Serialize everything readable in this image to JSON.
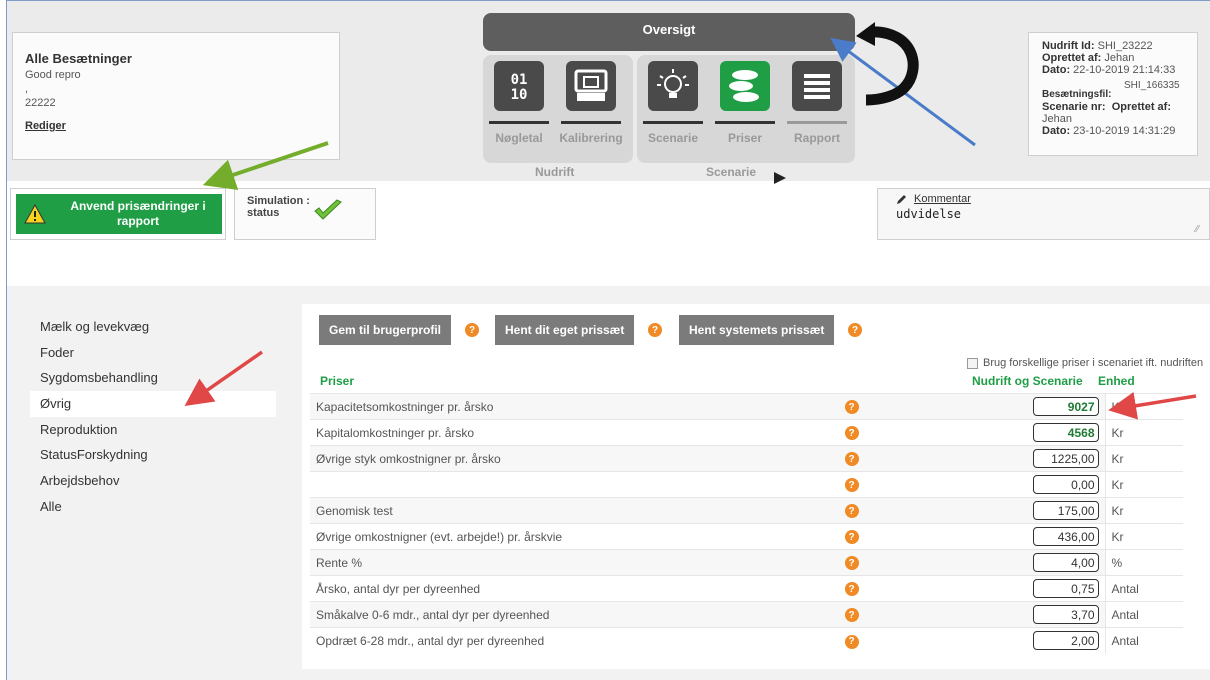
{
  "herd": {
    "title": "Alle Besætninger",
    "subtitle": "Good repro",
    "comma": ",",
    "number": "22222",
    "edit_label": "Rediger"
  },
  "workflow": {
    "overview_label": "Oversigt",
    "steps": [
      {
        "label": "Nøgletal",
        "icon": "binary-icon"
      },
      {
        "label": "Kalibrering",
        "icon": "monitor-icon"
      },
      {
        "label": "Scenarie",
        "icon": "lightbulb-icon"
      },
      {
        "label": "Priser",
        "icon": "coins-icon"
      },
      {
        "label": "Rapport",
        "icon": "list-icon"
      }
    ],
    "groups": [
      "Nudrift",
      "Scenarie"
    ],
    "active_step": "Priser"
  },
  "info": {
    "nudrift_id_label": "Nudrift Id:",
    "nudrift_id": "SHI_23222",
    "created_by_label": "Oprettet af:",
    "created_by": "Jehan",
    "date_label": "Dato:",
    "date": "22-10-2019 21:14:33",
    "herd_file_label": "Besætningsfil:",
    "herd_file": "SHI_166335",
    "scenario_label": "Scenarie nr:",
    "scenario_created_label": "Oprettet af:",
    "scenario_created_by": "Jehan",
    "scenario_date_label": "Dato:",
    "scenario_date": "23-10-2019 14:31:29"
  },
  "actions": {
    "apply_label_1": "Anvend prisændringer i",
    "apply_label_2": "rapport",
    "simulation_label_1": "Simulation :",
    "simulation_label_2": "status",
    "comment_link": "Kommentar",
    "comment_text": "udvidelse"
  },
  "nav": {
    "items": [
      "Mælk og levekvæg",
      "Foder",
      "Sygdomsbehandling",
      "Øvrig",
      "Reproduktion",
      "StatusForskydning",
      "Arbejdsbehov",
      "Alle"
    ],
    "active": "Øvrig"
  },
  "toolbar": {
    "save_profile": "Gem til brugerprofil",
    "load_own": "Hent dit eget prissæt",
    "load_system": "Hent systemets prissæt",
    "help_glyph": "?"
  },
  "table": {
    "diff_prices_label": "Brug forskellige priser i scenariet ift. nudriften",
    "col_prices": "Priser",
    "col_values": "Nudrift og Scenarie",
    "col_unit": "Enhed",
    "rows": [
      {
        "label": "Kapacitetsomkostninger pr. årsko",
        "value": "9027",
        "unit": "Kr",
        "bold": true
      },
      {
        "label": "Kapitalomkostninger pr. årsko",
        "value": "4568",
        "unit": "Kr",
        "bold": true
      },
      {
        "label": "Øvrige styk omkostnigner pr. årsko",
        "value": "1225,00",
        "unit": "Kr",
        "bold": false
      },
      {
        "label": "",
        "value": "0,00",
        "unit": "Kr",
        "bold": false
      },
      {
        "label": "Genomisk test",
        "value": "175,00",
        "unit": "Kr",
        "bold": false
      },
      {
        "label": "Øvrige omkostnigner (evt. arbejde!) pr. årskvie",
        "value": "436,00",
        "unit": "Kr",
        "bold": false
      },
      {
        "label": "Rente %",
        "value": "4,00",
        "unit": "%",
        "bold": false
      },
      {
        "label": "Årsko, antal dyr per dyreenhed",
        "value": "0,75",
        "unit": "Antal",
        "bold": false
      },
      {
        "label": "Småkalve 0-6 mdr., antal dyr per dyreenhed",
        "value": "3,70",
        "unit": "Antal",
        "bold": false
      },
      {
        "label": "Opdræt 6-28 mdr., antal dyr per dyreenhed",
        "value": "2,00",
        "unit": "Antal",
        "bold": false
      }
    ]
  },
  "colors": {
    "accent_green": "#1f9e46",
    "help_orange": "#f08a24",
    "annotation_green": "#74ad2c",
    "annotation_blue": "#4a7cc9",
    "annotation_red": "#e04848"
  }
}
